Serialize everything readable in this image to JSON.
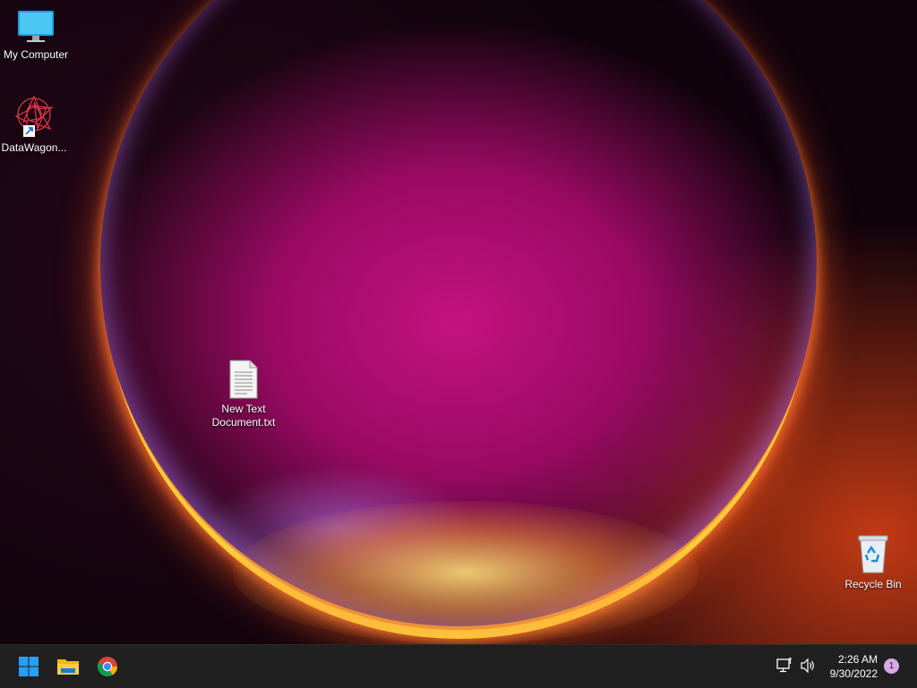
{
  "desktop": {
    "icons": {
      "my_computer": "My Computer",
      "datawagon": "DataWagon...",
      "text_doc_line1": "New Text",
      "text_doc_line2": "Document.txt",
      "recycle_bin": "Recycle Bin"
    }
  },
  "taskbar": {
    "apps": [
      "start-button",
      "file-explorer",
      "chrome"
    ],
    "time": "2:26 AM",
    "date": "9/30/2022",
    "notification_count": "1",
    "accent_color": "#0078d4"
  }
}
